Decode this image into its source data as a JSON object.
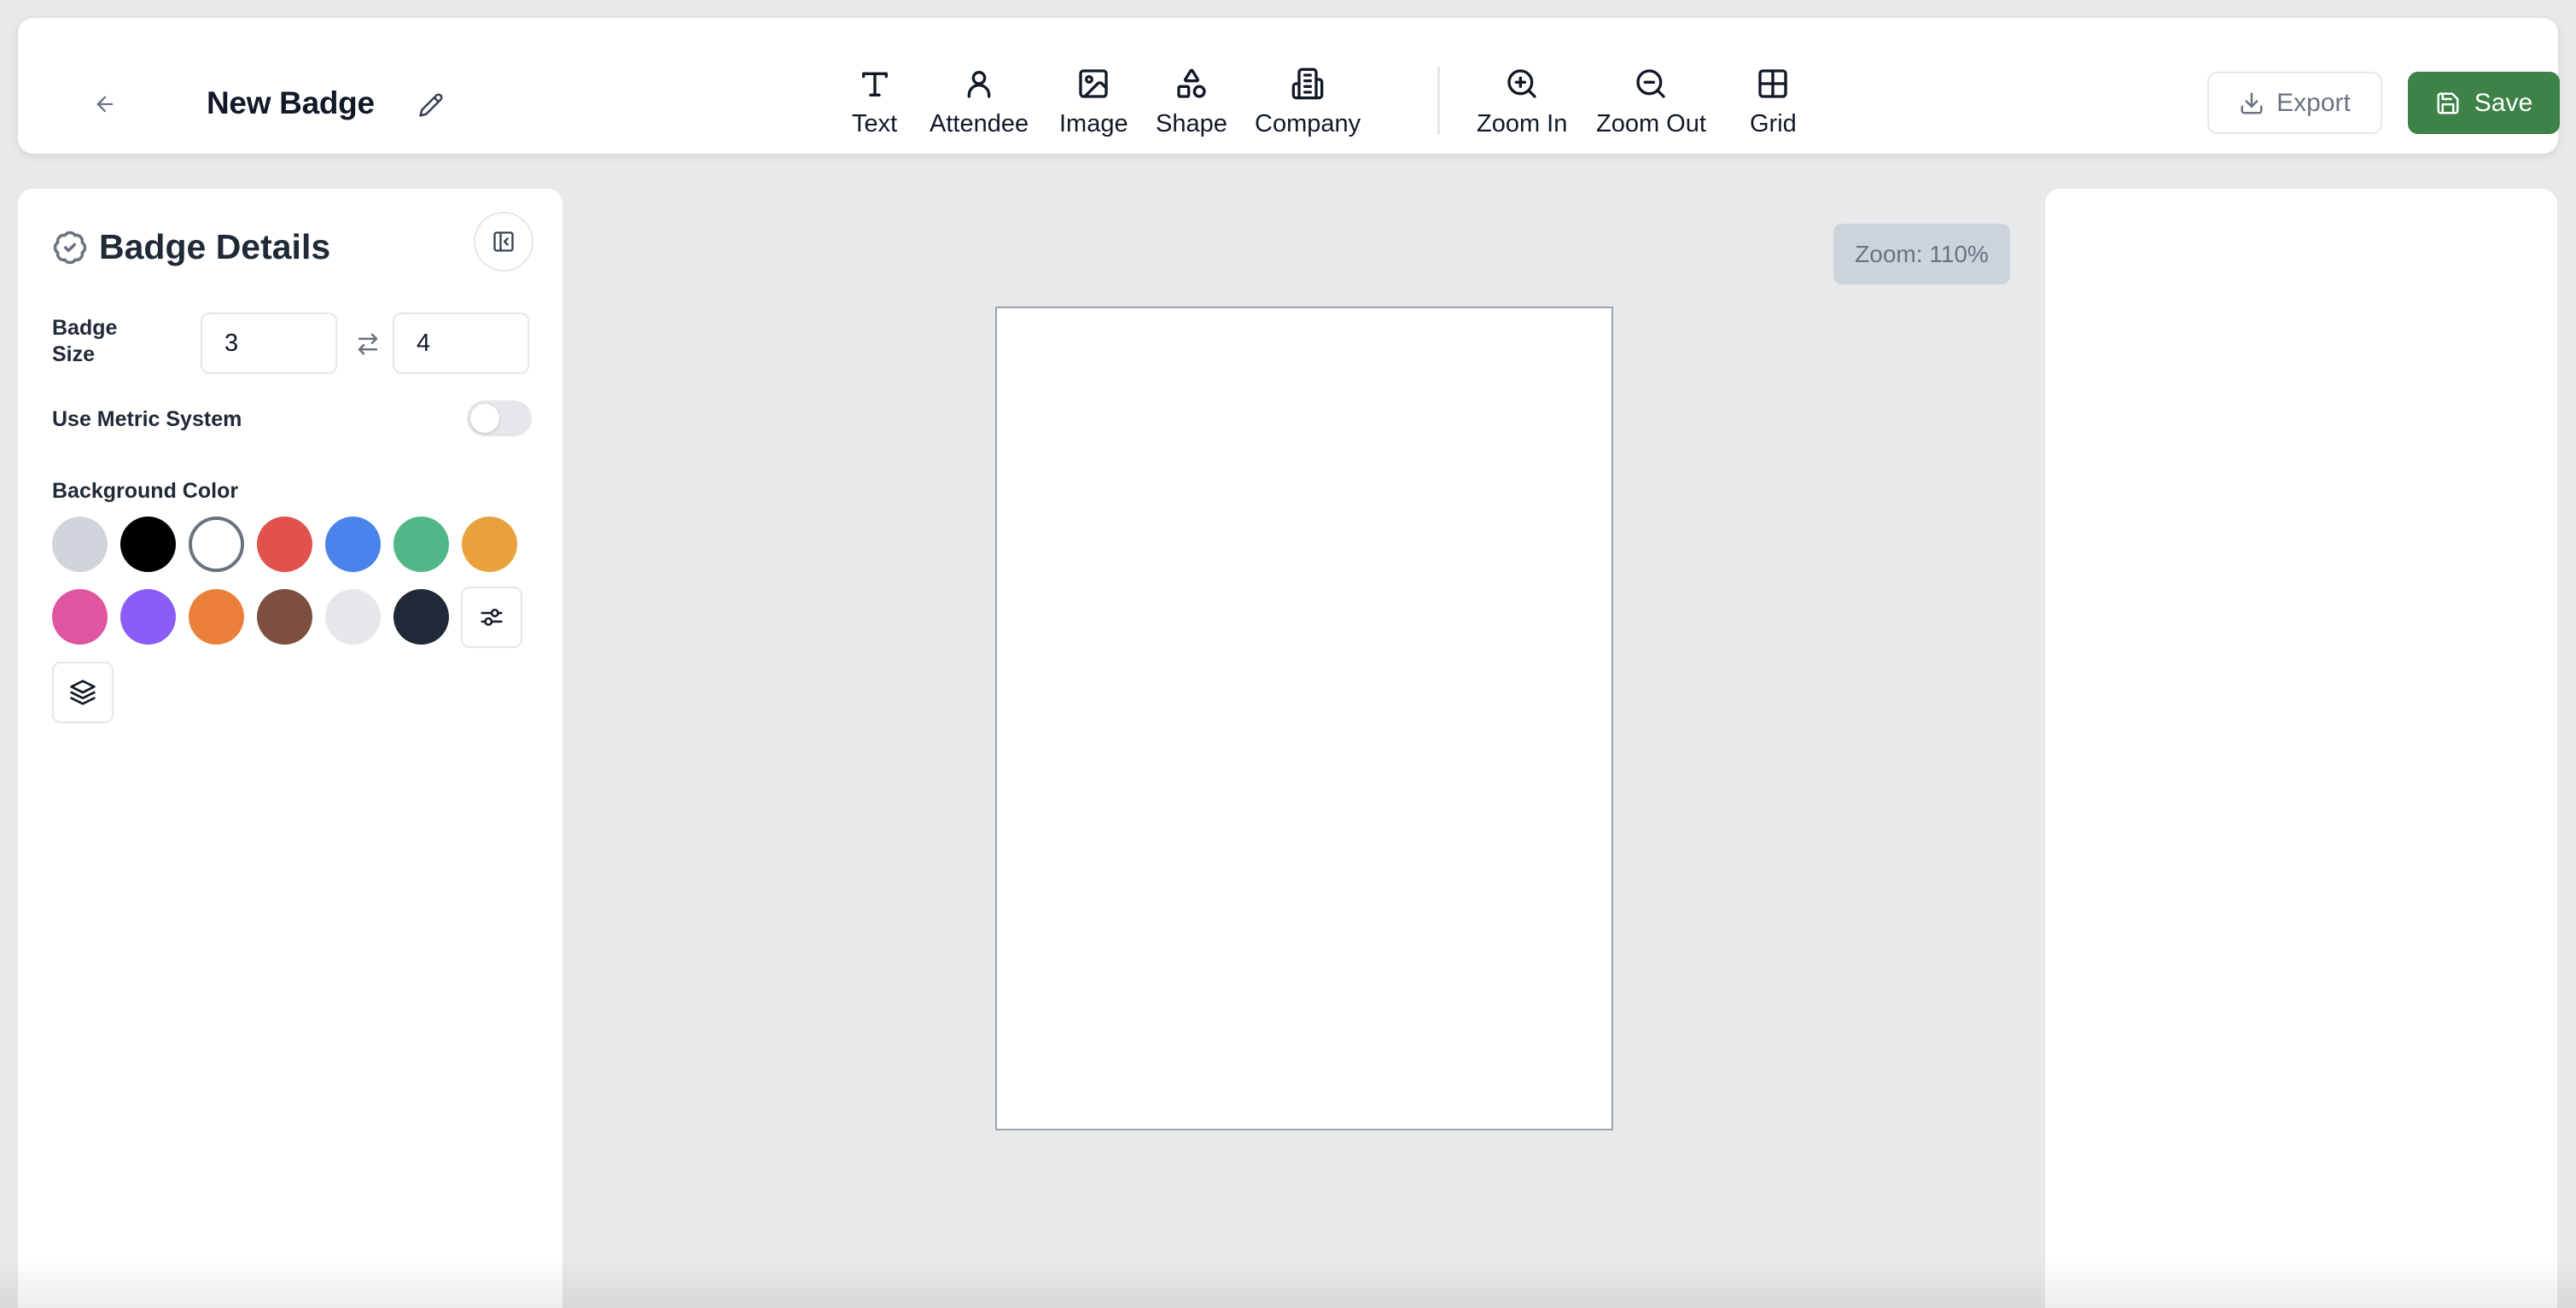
{
  "header": {
    "title": "New Badge",
    "icons": {
      "back": "arrow-left-icon",
      "edit": "pencil-icon"
    }
  },
  "toolbar": {
    "tools": [
      {
        "label": "Text",
        "icon": "text-icon"
      },
      {
        "label": "Attendee",
        "icon": "user-icon"
      },
      {
        "label": "Image",
        "icon": "image-icon"
      },
      {
        "label": "Shape",
        "icon": "shapes-icon"
      },
      {
        "label": "Company",
        "icon": "building-icon"
      }
    ],
    "view_tools": [
      {
        "label": "Zoom In",
        "icon": "zoom-in-icon"
      },
      {
        "label": "Zoom Out",
        "icon": "zoom-out-icon"
      },
      {
        "label": "Grid",
        "icon": "grid-icon"
      }
    ],
    "export_label": "Export",
    "save_label": "Save",
    "save_color": "#3d8246"
  },
  "panel": {
    "title": "Badge Details",
    "size_label": "Badge Size",
    "width_value": "3",
    "height_value": "4",
    "metric_label": "Use Metric System",
    "metric_enabled": false,
    "bg_label": "Background Color",
    "colors": [
      {
        "name": "light-gray",
        "hex": "#d1d5db"
      },
      {
        "name": "black",
        "hex": "#000000"
      },
      {
        "name": "white",
        "hex": "#ffffff",
        "selected": true
      },
      {
        "name": "red",
        "hex": "#e0524b"
      },
      {
        "name": "blue",
        "hex": "#4b83ec"
      },
      {
        "name": "green",
        "hex": "#52b788"
      },
      {
        "name": "amber",
        "hex": "#e9a23b"
      },
      {
        "name": "pink",
        "hex": "#e0559f"
      },
      {
        "name": "purple",
        "hex": "#8b5cf6"
      },
      {
        "name": "orange",
        "hex": "#ea7f3a"
      },
      {
        "name": "brown",
        "hex": "#7d4f3f"
      },
      {
        "name": "pale-gray",
        "hex": "#e5e7eb"
      },
      {
        "name": "navy",
        "hex": "#1f2937"
      }
    ]
  },
  "canvas": {
    "zoom_text": "Zoom: 110%"
  }
}
